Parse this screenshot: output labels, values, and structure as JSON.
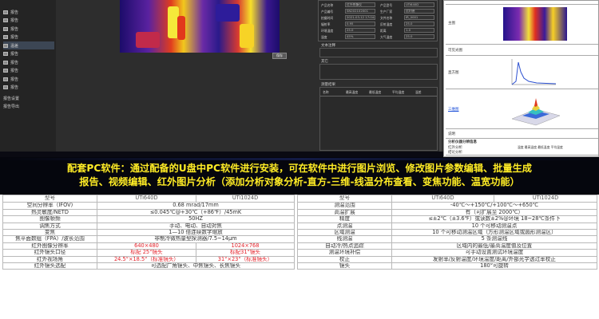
{
  "software": {
    "sidebar_items": [
      "报告",
      "报告",
      "报告",
      "报告",
      "温差",
      "报告",
      "报告",
      "报告",
      "报告",
      "报告"
    ],
    "active_index": 4,
    "bottom_items": [
      "报告设置",
      "报告导出"
    ],
    "button_label": "保存",
    "fields": [
      "产品名称",
      "产品型号",
      "产品编号",
      "生产厂家",
      "拍摄时间",
      "文件名称",
      "辐射率",
      "反射温度",
      "环境温度",
      "距离",
      "湿度",
      "大气温度"
    ],
    "field_values": [
      "红外热像仪",
      "UTi640D",
      "SN202102001",
      "优利德",
      "2021-03-12 17:04:34",
      "IR_0001",
      "0.95",
      "25.0",
      "25.0",
      "1.0",
      "45%",
      "25.0"
    ],
    "section_labels": [
      "文本注释",
      "其它",
      "测量结果"
    ],
    "result_headers": [
      "名称",
      "最高温度",
      "最低温度",
      "平均温度",
      "温差"
    ]
  },
  "report": {
    "captions": [
      "主图",
      "可见光图",
      "直方图",
      "三维图",
      "说明",
      "分析仪器分辨信息",
      "红外分析",
      "结论分析"
    ],
    "link_caption": "三维图",
    "footer_text": "温度  最高温度  最低温度  平均温度"
  },
  "caption": {
    "line1": "配套PC软件：通过配备的U盘中PC软件进行安装，可在软件中进行图片浏览、修改图片参数编辑、批量生成",
    "line2": "报告、视频编辑、红外图片分析（添加分析对象分析-直方-三维-线温分布查看、变焦功能、温宽功能）"
  },
  "spec_left": {
    "headers": [
      "型号",
      "UTi640D",
      "UTi1024D"
    ],
    "rows": [
      [
        "空间分辨率（IFOV)",
        "0.68 mrad/17mm",
        "",
        false
      ],
      [
        "热灵敏度/NETD",
        "≤0.045℃@+30℃（+86℉）/45mK",
        "",
        false
      ],
      [
        "图像帧频",
        "50HZ",
        "",
        false
      ],
      [
        "调焦方式",
        "手动、电动、自动对焦",
        "",
        false
      ],
      [
        "变焦",
        "1—10 倍连续数字缩放",
        "",
        false
      ],
      [
        "焦平面数组（FPA）/波长范围",
        "非制冷微热量型探测器/7.5~14μm",
        "",
        false
      ],
      [
        "红外图像分辨率",
        "640×480",
        "1024×768",
        true
      ],
      [
        "红外镜头口径",
        "标配 25°镜头",
        "标配31°镜头",
        true
      ],
      [
        "红外视场角",
        "24.5°×18.5°（标准镜头）",
        "31°×23°（标准镜头）",
        true
      ],
      [
        "红外镜头选配",
        "可选配广角镜头、中焦镜头、长焦镜头",
        "",
        false
      ]
    ]
  },
  "spec_right": {
    "headers": [
      "型号",
      "UTi640D",
      "UTi1024D"
    ],
    "rows": [
      [
        "测温范围",
        "-40℃～+150℃/+100℃～+650℃"
      ],
      [
        "高温扩展",
        "有（可扩展至 2000℃）"
      ],
      [
        "精度",
        "≤±2℃（±3.6℉）或读数±2%@环境 18~28℃条件下"
      ],
      [
        "点测温",
        "10 个可移动测温点"
      ],
      [
        "区域测温",
        "10 个可移动测温区域（方形测温区域或圆形测温区）"
      ],
      [
        "线测温",
        "5 条测温线"
      ],
      [
        "自动冷/热点追踪",
        "区域内的最低/最高温度值及位置"
      ],
      [
        "测温环境补偿",
        "可手动设置测试环境温度"
      ],
      [
        "校正",
        "发射率/反射温度/环境温度/距离/外部光学透过率校正"
      ],
      [
        "镜头",
        "180°可旋转"
      ]
    ]
  }
}
